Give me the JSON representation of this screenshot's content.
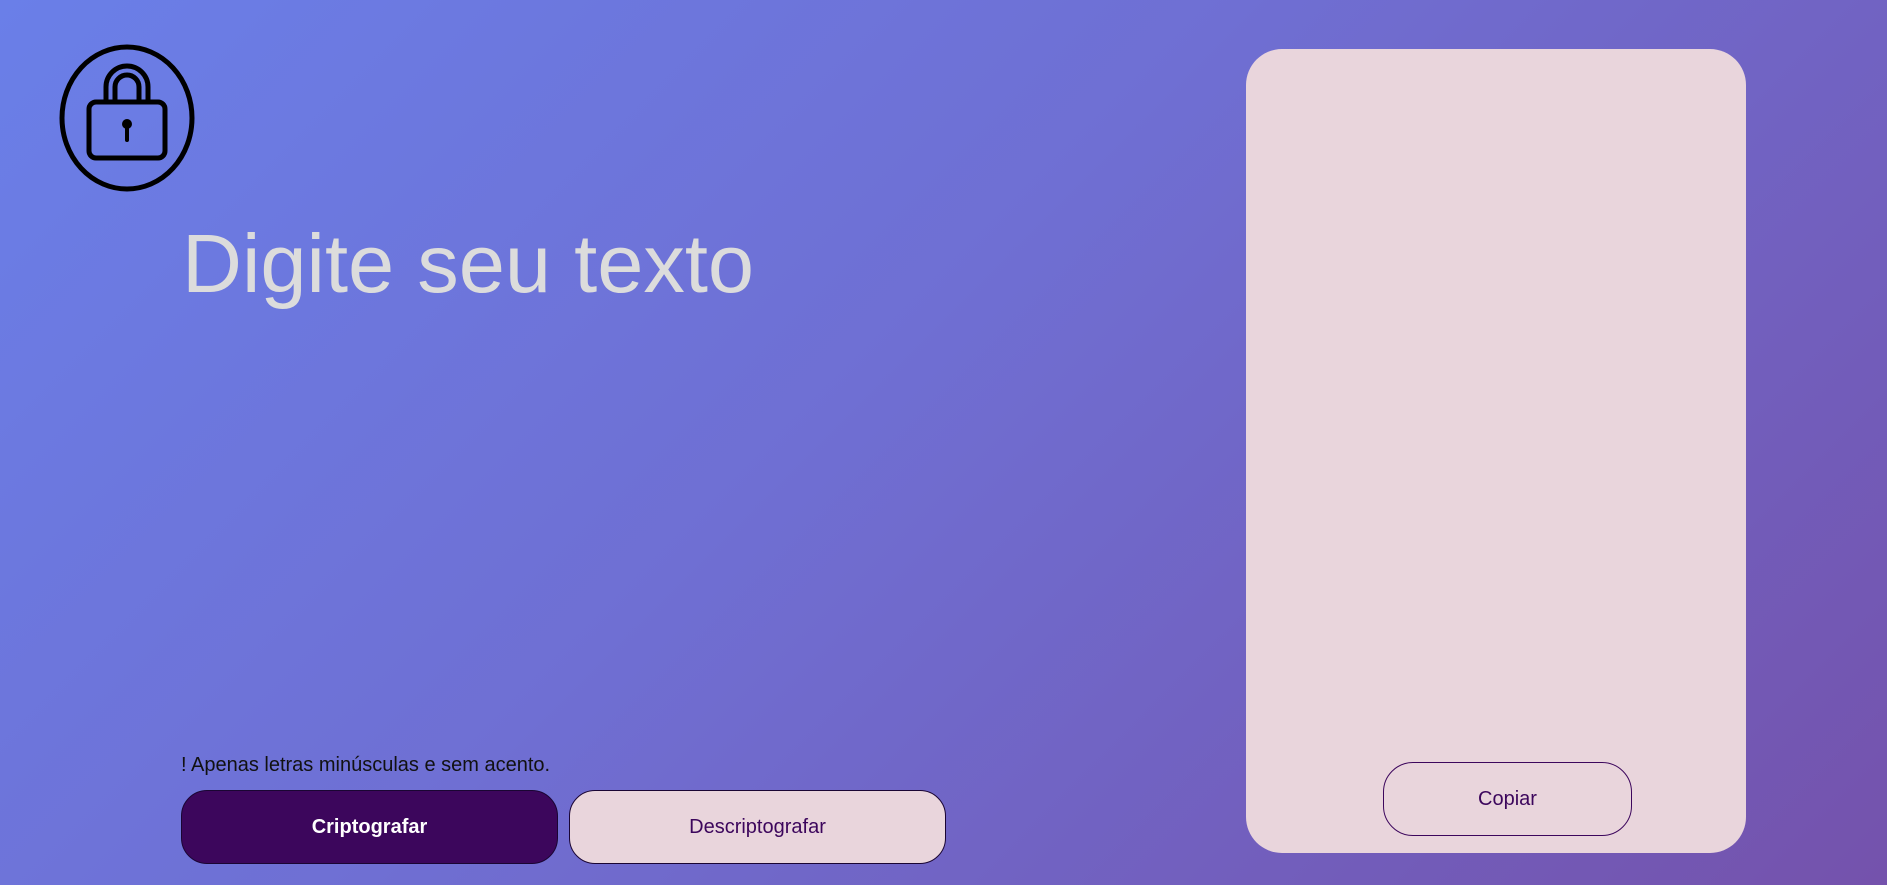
{
  "logo": {
    "icon": "lock-icon"
  },
  "input": {
    "placeholder": "Digite seu texto",
    "value": ""
  },
  "hint": {
    "text": "! Apenas letras minúsculas e sem acento."
  },
  "buttons": {
    "encrypt_label": "Criptografar",
    "decrypt_label": "Descriptografar"
  },
  "output": {
    "text": "",
    "copy_label": "Copiar"
  },
  "colors": {
    "accent": "#3c065c",
    "panel": "#e9d5dc",
    "gradient_start": "#6a7fe8",
    "gradient_end": "#7452ac"
  }
}
